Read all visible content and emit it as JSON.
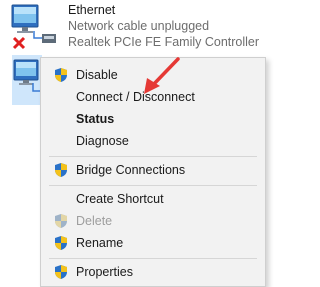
{
  "adapter": {
    "name": "Ethernet",
    "status": "Network cable unplugged",
    "device": "Realtek PCIe FE Family Controller"
  },
  "menu": {
    "disable": "Disable",
    "connect": "Connect / Disconnect",
    "status": "Status",
    "diagnose": "Diagnose",
    "bridge": "Bridge Connections",
    "shortcut": "Create Shortcut",
    "delete": "Delete",
    "rename": "Rename",
    "properties": "Properties"
  },
  "icons": {
    "network_adapter": "network-adapter-icon",
    "error_badge": "red-x-icon",
    "uac_shield": "uac-shield-icon",
    "annotation_arrow": "red-arrow"
  },
  "colors": {
    "menu_bg": "#f2f2f2",
    "disabled_text": "#9e9e9e",
    "status_text": "#6d6d6d",
    "arrow": "#e53935",
    "error_x": "#e02020"
  }
}
